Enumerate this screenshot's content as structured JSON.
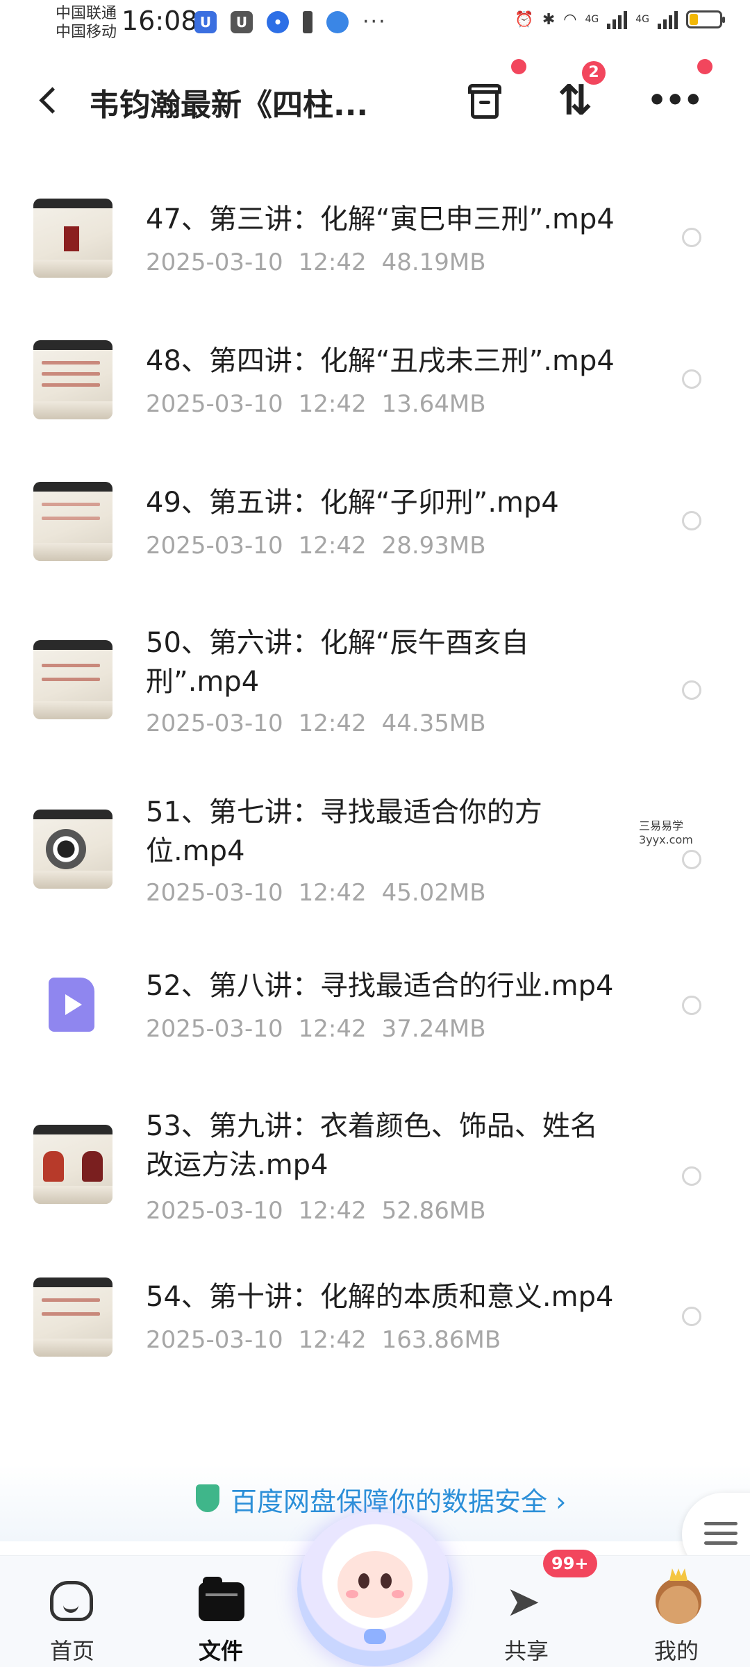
{
  "status_bar": {
    "carrier1": "中国联通",
    "carrier2": "中国移动",
    "time": "16:08",
    "signal1": "4G",
    "signal2": "4G"
  },
  "header": {
    "title": "韦钧瀚最新《四柱...",
    "sort_badge": "2"
  },
  "files": [
    {
      "name": "47、第三讲：化解“寅巳申三刑”.mp4",
      "date": "2025-03-10",
      "time": "12:42",
      "size": "48.19MB"
    },
    {
      "name": "48、第四讲：化解“丑戌未三刑”.mp4",
      "date": "2025-03-10",
      "time": "12:42",
      "size": "13.64MB"
    },
    {
      "name": "49、第五讲：化解“子卯刑”.mp4",
      "date": "2025-03-10",
      "time": "12:42",
      "size": "28.93MB"
    },
    {
      "name": "50、第六讲：化解“辰午酉亥自刑”.mp4",
      "date": "2025-03-10",
      "time": "12:42",
      "size": "44.35MB"
    },
    {
      "name": "51、第七讲：寻找最适合你的方位.mp4",
      "date": "2025-03-10",
      "time": "12:42",
      "size": "45.02MB"
    },
    {
      "name": "52、第八讲：寻找最适合的行业.mp4",
      "date": "2025-03-10",
      "time": "12:42",
      "size": "37.24MB"
    },
    {
      "name": "53、第九讲：衣着颜色、饰品、姓名改运方法.mp4",
      "date": "2025-03-10",
      "time": "12:42",
      "size": "52.86MB"
    },
    {
      "name": "54、第十讲：化解的本质和意义.mp4",
      "date": "2025-03-10",
      "time": "12:42",
      "size": "163.86MB"
    }
  ],
  "watermark": {
    "line1": "三易易学",
    "line2": "3yyx.com"
  },
  "banner": {
    "text": "百度网盘保障你的数据安全 ›"
  },
  "bottom_nav": {
    "tabs": [
      {
        "label": "首页"
      },
      {
        "label": "文件"
      },
      {
        "label": "共享"
      },
      {
        "label": "我的"
      }
    ],
    "share_badge": "99+"
  }
}
